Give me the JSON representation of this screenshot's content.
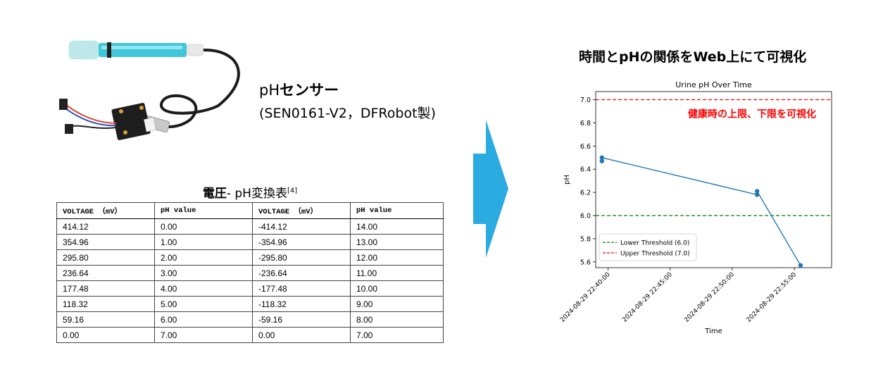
{
  "sensor": {
    "title_latin": "pH",
    "title_jp": "センサー",
    "model": "(SEN0161-V2，DFRobot製)"
  },
  "table": {
    "title_bold": "電圧",
    "title_rest": "- pH変換表",
    "title_ref": "[4]",
    "headers": [
      "VOLTAGE （mV）",
      "pH value",
      "VOLTAGE （mV）",
      "pH value"
    ],
    "rows": [
      [
        "414.12",
        "0.00",
        "-414.12",
        "14.00"
      ],
      [
        "354.96",
        "1.00",
        "-354.96",
        "13.00"
      ],
      [
        "295.80",
        "2.00",
        "-295.80",
        "12.00"
      ],
      [
        "236.64",
        "3.00",
        "-236.64",
        "11.00"
      ],
      [
        "177.48",
        "4.00",
        "-177.48",
        "10.00"
      ],
      [
        "118.32",
        "5.00",
        "-118.32",
        "9.00"
      ],
      [
        "59.16",
        "6.00",
        "-59.16",
        "8.00"
      ],
      [
        "0.00",
        "7.00",
        "0.00",
        "7.00"
      ]
    ]
  },
  "right_title": "時間とpHの関係をWeb上にて可視化",
  "colors": {
    "arrow": "#29abe2",
    "series": "#1f77b4",
    "lower_threshold": "#008000",
    "upper_threshold": "#ff0000",
    "annotation": "#ff0000"
  },
  "chart_data": {
    "type": "line",
    "title": "Urine pH Over Time",
    "xlabel": "Time",
    "ylabel": "pH",
    "x_ticks": [
      "2024-08-29 22:40:00",
      "2024-08-29 22:45:00",
      "2024-08-29 22:50:00",
      "2024-08-29 22:55:00"
    ],
    "y_ticks": [
      "5.6",
      "5.8",
      "6.0",
      "6.2",
      "6.4",
      "6.6",
      "6.8",
      "7.0"
    ],
    "ylim": [
      5.55,
      7.07
    ],
    "xlim": [
      "2024-08-29 22:39:00",
      "2024-08-29 22:58:00"
    ],
    "series": [
      {
        "points": [
          {
            "x": "2024-08-29 22:39:30",
            "y": 6.47
          },
          {
            "x": "2024-08-29 22:39:30",
            "y": 6.5
          },
          {
            "x": "2024-08-29 22:52:00",
            "y": 6.18
          },
          {
            "x": "2024-08-29 22:52:00",
            "y": 6.21
          },
          {
            "x": "2024-08-29 22:55:30",
            "y": 5.57
          }
        ]
      }
    ],
    "thresholds": [
      {
        "name": "Lower Threshold (6.0)",
        "value": 6.0,
        "style": "dashed",
        "color": "#008000"
      },
      {
        "name": "Upper Threshold (7.0)",
        "value": 7.0,
        "style": "dashed",
        "color": "#ff0000"
      }
    ],
    "annotation": "健康時の上限、下限を可視化",
    "legend_position": "lower-left",
    "grid": false
  }
}
